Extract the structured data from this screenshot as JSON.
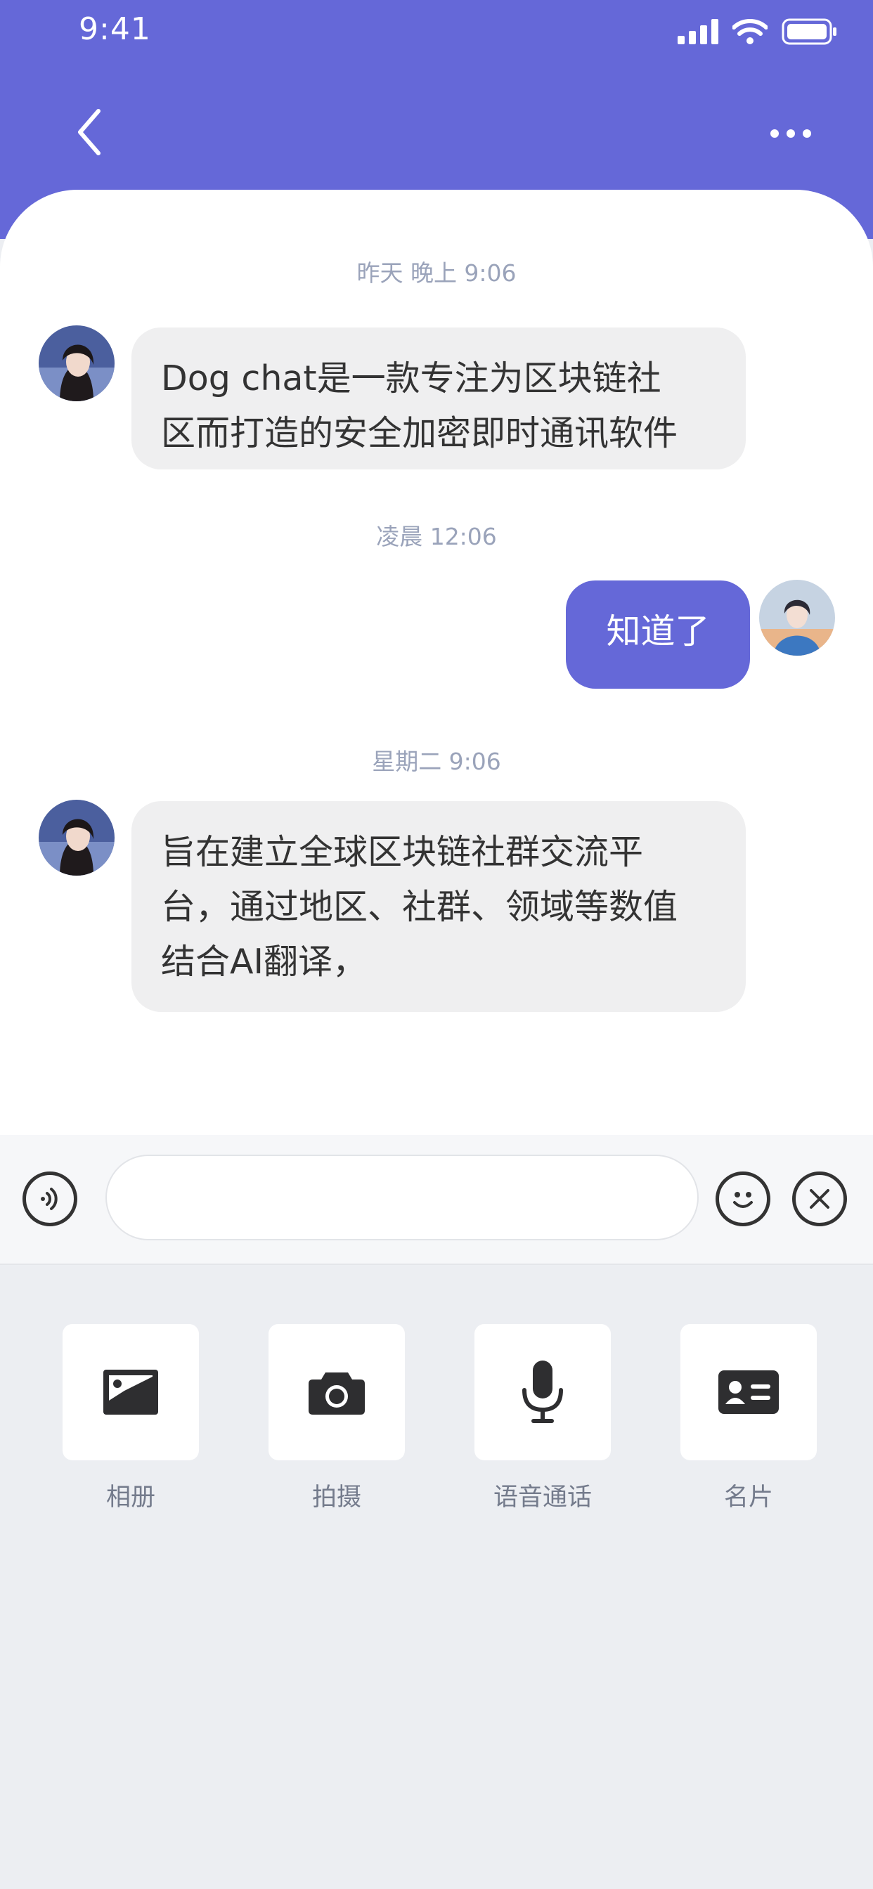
{
  "status_bar": {
    "time": "9:41"
  },
  "header": {
    "back_icon": "chevron-left-icon",
    "more_icon": "more-horizontal-icon",
    "background": "#6568d8"
  },
  "messages": [
    {
      "timestamp": "昨天  晚上 9:06",
      "from": "other",
      "text": "Dog chat是一款专注为区块链社\n区而打造的安全加密即时通讯软件"
    },
    {
      "timestamp": "凌晨 12:06",
      "from": "me",
      "text": "知道了"
    },
    {
      "timestamp": "星期二  9:06",
      "from": "other",
      "text": "旨在建立全球区块链社群交流平\n台，通过地区、社群、领域等数值\n结合AI翻译，"
    }
  ],
  "input_bar": {
    "value": "",
    "placeholder": "",
    "voice_icon": "voice-icon",
    "emoji_icon": "emoji-icon",
    "close_icon": "close-icon"
  },
  "tools": [
    {
      "label": "相册",
      "icon": "image-icon"
    },
    {
      "label": "拍摄",
      "icon": "camera-icon"
    },
    {
      "label": "语音通话",
      "icon": "microphone-icon"
    },
    {
      "label": "名片",
      "icon": "contact-card-icon"
    }
  ]
}
